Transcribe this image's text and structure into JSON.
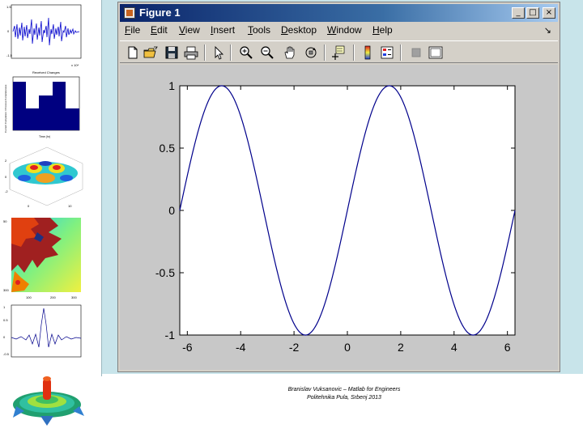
{
  "window": {
    "title": "Figure 1",
    "buttons": {
      "minimize": "_",
      "maximize": "□",
      "close": "×"
    }
  },
  "menu": {
    "items": [
      {
        "underline": "F",
        "rest": "ile"
      },
      {
        "underline": "E",
        "rest": "dit"
      },
      {
        "underline": "V",
        "rest": "iew"
      },
      {
        "underline": "I",
        "rest": "nsert"
      },
      {
        "underline": "T",
        "rest": "ools"
      },
      {
        "underline": "D",
        "rest": "esktop"
      },
      {
        "underline": "W",
        "rest": "indow"
      },
      {
        "underline": "H",
        "rest": "elp"
      }
    ],
    "dock_arrow": "↘"
  },
  "toolbar": {
    "icons": [
      "new-file-icon",
      "open-folder-icon",
      "save-icon",
      "print-icon",
      "pointer-icon",
      "zoom-in-icon",
      "zoom-out-icon",
      "pan-hand-icon",
      "rotate-3d-icon",
      "data-cursor-icon",
      "colorbar-icon",
      "legend-icon",
      "hide-plot-tools-icon",
      "show-plot-tools-icon"
    ]
  },
  "chart_data": {
    "type": "line",
    "function": "sin(x)",
    "xlim": [
      -6.2832,
      6.2832
    ],
    "ylim": [
      -1,
      1
    ],
    "x_ticks": [
      -6,
      -4,
      -2,
      0,
      2,
      4,
      6
    ],
    "x_tick_labels": [
      "-6",
      "-4",
      "-2",
      "0",
      "2",
      "4",
      "6"
    ],
    "y_ticks": [
      1,
      0.5,
      0,
      -0.5,
      -1
    ],
    "y_tick_labels": [
      "1",
      "0.5",
      "0",
      "-0.5",
      "-1"
    ],
    "title": "",
    "xlabel": "",
    "ylabel": "",
    "grid": false,
    "line_color": "#00008b",
    "series": [
      {
        "x": [
          -6.2832,
          -5.4978,
          -4.7124,
          -3.927,
          -3.1416,
          -2.3562,
          -1.5708,
          -0.7854,
          0,
          0.7854,
          1.5708,
          2.3562,
          3.1416,
          3.927,
          4.7124,
          5.4978,
          6.2832
        ],
        "y": [
          0,
          0.7071,
          1,
          0.7071,
          0,
          -0.7071,
          -1,
          -0.7071,
          0,
          0.7071,
          1,
          0.7071,
          0,
          -0.7071,
          -1,
          -0.7071,
          0
        ]
      }
    ]
  },
  "thumbnails": {
    "signal_xlabel": "x 10⁴",
    "histogram_title": "Received Changes",
    "histogram_ylabel": "Current Completion / Process Completeness",
    "histogram_xlabel": "Time (hr)"
  },
  "footer": {
    "line1": "Branislav Vuksanovic – Matlab for Engineers",
    "line2": "Politehnika Pula, Srbenj 2013"
  }
}
